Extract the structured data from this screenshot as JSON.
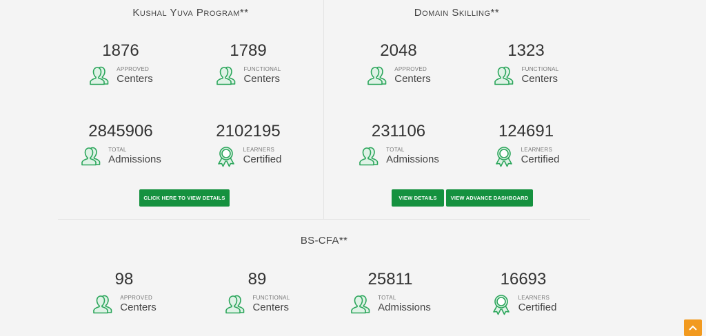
{
  "colors": {
    "accent": "#15913f",
    "icon_green": "#2aa55a",
    "scroll_top": "#f29a1f"
  },
  "kushal": {
    "title": "Kushal Yuva Program**",
    "stats": [
      {
        "value": "1876",
        "small": "APPROVED",
        "big": "Centers",
        "icon": "users-icon"
      },
      {
        "value": "1789",
        "small": "FUNCTIONAL",
        "big": "Centers",
        "icon": "users-icon"
      },
      {
        "value": "2845906",
        "small": "TOTAL",
        "big": "Admissions",
        "icon": "users-icon"
      },
      {
        "value": "2102195",
        "small": "LEARNERS",
        "big": "Certified",
        "icon": "award-icon"
      }
    ],
    "button": "CLICK HERE TO VIEW DETAILS"
  },
  "domain": {
    "title": "Domain Skilling**",
    "stats": [
      {
        "value": "2048",
        "small": "APPROVED",
        "big": "Centers",
        "icon": "users-icon"
      },
      {
        "value": "1323",
        "small": "FUNCTIONAL",
        "big": "Centers",
        "icon": "users-icon"
      },
      {
        "value": "231106",
        "small": "TOTAL",
        "big": "Admissions",
        "icon": "users-icon"
      },
      {
        "value": "124691",
        "small": "LEARNERS",
        "big": "Certified",
        "icon": "award-icon"
      }
    ],
    "button_details": "VIEW DETAILS",
    "button_advance": "VIEW ADVANCE DASHBOARD"
  },
  "bscfa": {
    "title": "BS-CFA**",
    "stats": [
      {
        "value": "98",
        "small": "APPROVED",
        "big": "Centers",
        "icon": "users-icon"
      },
      {
        "value": "89",
        "small": "FUNCTIONAL",
        "big": "Centers",
        "icon": "users-icon"
      },
      {
        "value": "25811",
        "small": "TOTAL",
        "big": "Admissions",
        "icon": "users-icon"
      },
      {
        "value": "16693",
        "small": "LEARNERS",
        "big": "Certified",
        "icon": "award-icon"
      }
    ]
  },
  "scroll_top_icon": "chevron-up-icon"
}
